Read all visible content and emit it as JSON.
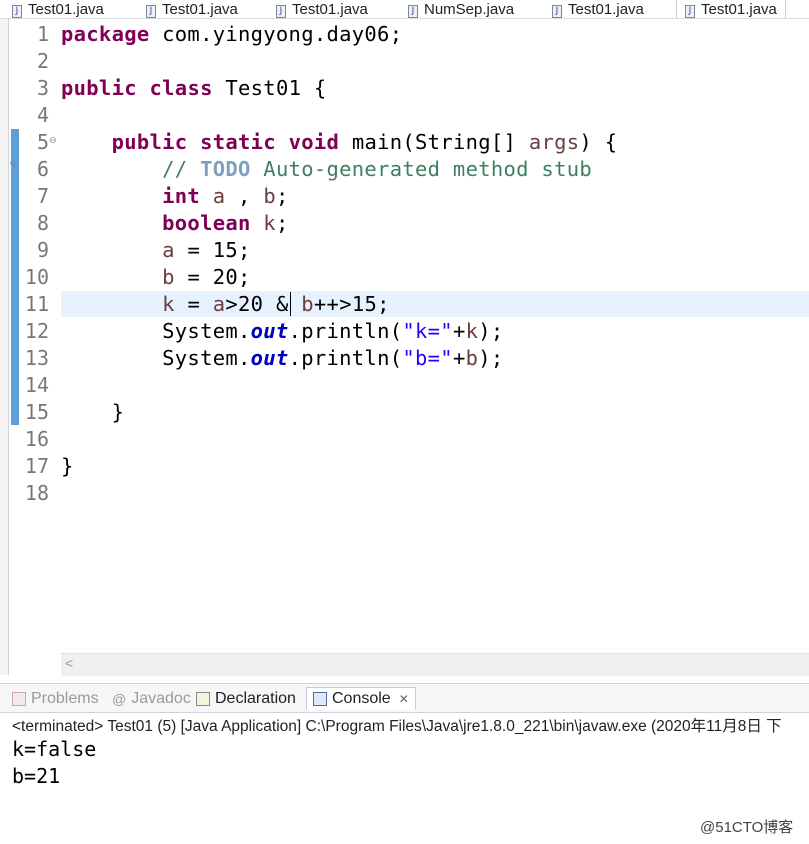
{
  "editor_tabs": [
    {
      "label": "Test01.java",
      "active": false
    },
    {
      "label": "Test01.java",
      "active": false
    },
    {
      "label": "Test01.java",
      "active": false
    },
    {
      "label": "NumSep.java",
      "active": false
    },
    {
      "label": "Test01.java",
      "active": false
    },
    {
      "label": "Test01.java",
      "active": true
    }
  ],
  "editor": {
    "lines": [
      {
        "num": "1"
      },
      {
        "num": "2"
      },
      {
        "num": "3"
      },
      {
        "num": "4"
      },
      {
        "num": "5"
      },
      {
        "num": "6"
      },
      {
        "num": "7"
      },
      {
        "num": "8"
      },
      {
        "num": "9"
      },
      {
        "num": "10"
      },
      {
        "num": "11"
      },
      {
        "num": "12"
      },
      {
        "num": "13"
      },
      {
        "num": "14"
      },
      {
        "num": "15"
      },
      {
        "num": "16"
      },
      {
        "num": "17"
      },
      {
        "num": "18"
      }
    ],
    "code": {
      "l1_kw": "package",
      "l1_rest": " com.yingyong.day06;",
      "l3_kw1": "public",
      "l3_kw2": "class",
      "l3_rest": " Test01 {",
      "l5_kw1": "public",
      "l5_kw2": "static",
      "l5_kw3": "void",
      "l5_mid": " main(String[] ",
      "l5_var": "args",
      "l5_end": ") {",
      "l6_c1": "// ",
      "l6_todo": "TODO",
      "l6_c2": " Auto-generated method stub",
      "l7_kw": "int",
      "l7_a": "a",
      "l7_sep": " , ",
      "l7_b": "b",
      "l7_end": ";",
      "l8_kw": "boolean",
      "l8_k": "k",
      "l8_end": ";",
      "l9_a": "a",
      "l9_rest": " = 15;",
      "l10_b": "b",
      "l10_rest": " = 20;",
      "l11_k": "k",
      "l11_eq": " = ",
      "l11_a": "a",
      "l11_mid": ">20 & ",
      "l11_b": "b",
      "l11_end": "++>15;",
      "l12_pre": "System.",
      "l12_out": "out",
      "l12_mid": ".println(",
      "l12_str": "\"k=\"",
      "l12_plus": "+",
      "l12_k": "k",
      "l12_end": ");",
      "l13_pre": "System.",
      "l13_out": "out",
      "l13_mid": ".println(",
      "l13_str": "\"b=\"",
      "l13_plus": "+",
      "l13_b": "b",
      "l13_end": ");",
      "l15": "}",
      "l17": "}"
    },
    "scroll_left": "<"
  },
  "panel_tabs": [
    {
      "label": "Problems",
      "active": false
    },
    {
      "label": "Javadoc",
      "active": false
    },
    {
      "label": "Declaration",
      "active": false
    },
    {
      "label": "Console",
      "active": true
    }
  ],
  "console": {
    "status": "<terminated> Test01 (5) [Java Application] C:\\Program Files\\Java\\jre1.8.0_221\\bin\\javaw.exe  (2020年11月8日 下",
    "output": [
      "k=false",
      "b=21"
    ]
  },
  "watermark": "@51CTO博客",
  "colors": {
    "keyword": "#7f0055",
    "comment": "#3f7f5f",
    "field": "#0000c0",
    "string": "#2a00ff",
    "current_line": "#e8f2fe"
  }
}
